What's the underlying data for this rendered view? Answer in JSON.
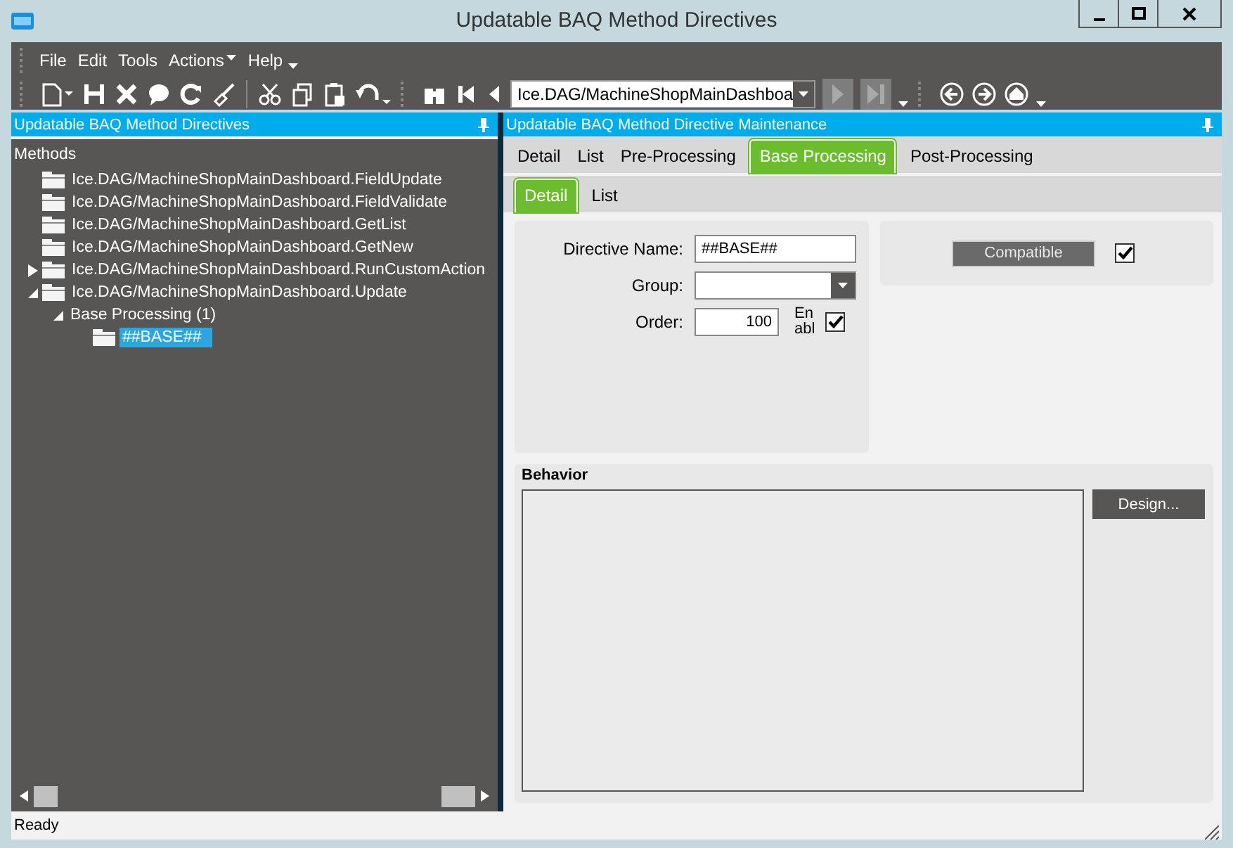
{
  "window": {
    "title": "Updatable BAQ Method Directives"
  },
  "menu": [
    "File",
    "Edit",
    "Tools",
    "Actions",
    "Help"
  ],
  "toolbar": {
    "method_combo": "Ice.DAG/MachineShopMainDashboa"
  },
  "left_panel": {
    "title": "Updatable BAQ Method Directives",
    "tree": {
      "label": "Methods",
      "children": [
        {
          "label": "Ice.DAG/MachineShopMainDashboard.FieldUpdate",
          "selected": false
        },
        {
          "label": "Ice.DAG/MachineShopMainDashboard.FieldValidate",
          "selected": false
        },
        {
          "label": "Ice.DAG/MachineShopMainDashboard.GetList",
          "selected": false
        },
        {
          "label": "Ice.DAG/MachineShopMainDashboard.GetNew",
          "selected": false
        },
        {
          "label": "Ice.DAG/MachineShopMainDashboard.RunCustomAction",
          "selected": false,
          "expanded": false
        },
        {
          "label": "Ice.DAG/MachineShopMainDashboard.Update",
          "selected": false,
          "expanded": true,
          "children": [
            {
              "label": "Base Processing (1)",
              "kind": "group",
              "selected": false,
              "expanded": true,
              "children": [
                {
                  "label": "##BASE##",
                  "selected": true
                }
              ]
            }
          ]
        }
      ]
    }
  },
  "right_panel": {
    "title": "Updatable BAQ Method Directive Maintenance",
    "tabs": [
      {
        "label": "Detail",
        "selected": false
      },
      {
        "label": "List",
        "selected": false
      },
      {
        "label": "Pre-Processing",
        "selected": false
      },
      {
        "label": "Base Processing",
        "selected": true
      },
      {
        "label": "Post-Processing",
        "selected": false
      }
    ],
    "subtabs": [
      {
        "label": "Detail",
        "selected": true
      },
      {
        "label": "List",
        "selected": false
      }
    ],
    "directive_name": {
      "label": "Directive Name:",
      "value": "##BASE##"
    },
    "group": {
      "label": "Group:"
    },
    "order": {
      "label": "Order:",
      "value": "100"
    },
    "enabled": {
      "label": "En abl",
      "checked": true
    },
    "compatible": {
      "label": "Compatible",
      "checked": true
    },
    "behavior": {
      "title": "Behavior",
      "button": "Design..."
    }
  },
  "status_bar": "Ready"
}
